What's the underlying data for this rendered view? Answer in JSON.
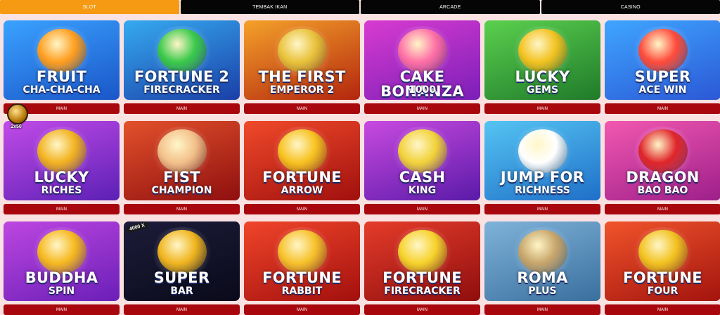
{
  "tabs": [
    {
      "label": "SLOT",
      "active": true
    },
    {
      "label": "TEMBAK IKAN",
      "active": false
    },
    {
      "label": "ARCADE",
      "active": false
    },
    {
      "label": "CASINO",
      "active": false
    }
  ],
  "floating_badge": {
    "text": "2x50"
  },
  "games": [
    {
      "line1": "FRUIT",
      "line2": "CHA-CHA-CHA",
      "button": "MAIN",
      "colors": [
        "#3aa2ff",
        "#1a56c8"
      ],
      "accent": "#ff9d1e"
    },
    {
      "line1": "FORTUNE 2",
      "line2": "FIRECRACKER",
      "button": "MAIN",
      "colors": [
        "#36aaf0",
        "#1a3fa8"
      ],
      "accent": "#39c94a"
    },
    {
      "line1": "THE FIRST",
      "line2": "EMPEROR 2",
      "button": "MAIN",
      "colors": [
        "#f4a12a",
        "#b3260e"
      ],
      "accent": "#e8c23a"
    },
    {
      "line1": "CAKE BONANZA",
      "line2": "1000",
      "button": "MAIN",
      "colors": [
        "#d83bd0",
        "#7b1fb8"
      ],
      "accent": "#ff6fa6"
    },
    {
      "line1": "LUCKY",
      "line2": "GEMS",
      "button": "MAIN",
      "colors": [
        "#5bd04e",
        "#1f7a2a"
      ],
      "accent": "#f2c21f"
    },
    {
      "line1": "SUPER",
      "line2": "ACE WIN",
      "button": "MAIN",
      "colors": [
        "#3fa6ff",
        "#2b58d6"
      ],
      "accent": "#ff4a3a"
    },
    {
      "line1": "LUCKY",
      "line2": "RICHES",
      "button": "MAIN",
      "colors": [
        "#c24be8",
        "#5b20b5"
      ],
      "accent": "#f2b21f"
    },
    {
      "line1": "FIST",
      "line2": "CHAMPION",
      "button": "MAIN",
      "colors": [
        "#e2512b",
        "#8f0f0f"
      ],
      "accent": "#f3c08a"
    },
    {
      "line1": "FORTUNE",
      "line2": "ARROW",
      "button": "MAIN",
      "colors": [
        "#f04a2a",
        "#a0100e"
      ],
      "accent": "#f7c21f"
    },
    {
      "line1": "CASH",
      "line2": "KING",
      "button": "MAIN",
      "colors": [
        "#c94ae0",
        "#5a1aa8"
      ],
      "accent": "#f2d23a"
    },
    {
      "line1": "JUMP FOR",
      "line2": "RICHNESS",
      "button": "MAIN",
      "colors": [
        "#55c4f2",
        "#1f6fc8"
      ],
      "accent": "#ffffff"
    },
    {
      "line1": "DRAGON",
      "line2": "BAO BAO",
      "button": "MAIN",
      "colors": [
        "#f258b0",
        "#9d1f8a"
      ],
      "accent": "#e0252a"
    },
    {
      "line1": "BUDDHA",
      "line2": "SPIN",
      "button": "MAIN",
      "colors": [
        "#bd46e0",
        "#6a1fb8"
      ],
      "accent": "#f6b81e"
    },
    {
      "line1": "SUPER",
      "line2": "BAR",
      "button": "MAIN",
      "colors": [
        "#1c1c3a",
        "#0a0a1a"
      ],
      "accent": "#f0b41e",
      "tag": "4000 X"
    },
    {
      "line1": "FORTUNE",
      "line2": "RABBIT",
      "button": "MAIN",
      "colors": [
        "#f0452a",
        "#a3100e"
      ],
      "accent": "#f6c12a"
    },
    {
      "line1": "FORTUNE",
      "line2": "FIRECRACKER",
      "button": "MAIN",
      "colors": [
        "#e53c2a",
        "#8f0e0e"
      ],
      "accent": "#f6d22a"
    },
    {
      "line1": "ROMA",
      "line2": "PLUS",
      "button": "MAIN",
      "colors": [
        "#7fb3d9",
        "#3a6f9e"
      ],
      "accent": "#c7a56a"
    },
    {
      "line1": "FORTUNE",
      "line2": "FOUR",
      "button": "MAIN",
      "colors": [
        "#f0542b",
        "#a3140e"
      ],
      "accent": "#f2c21f"
    }
  ]
}
